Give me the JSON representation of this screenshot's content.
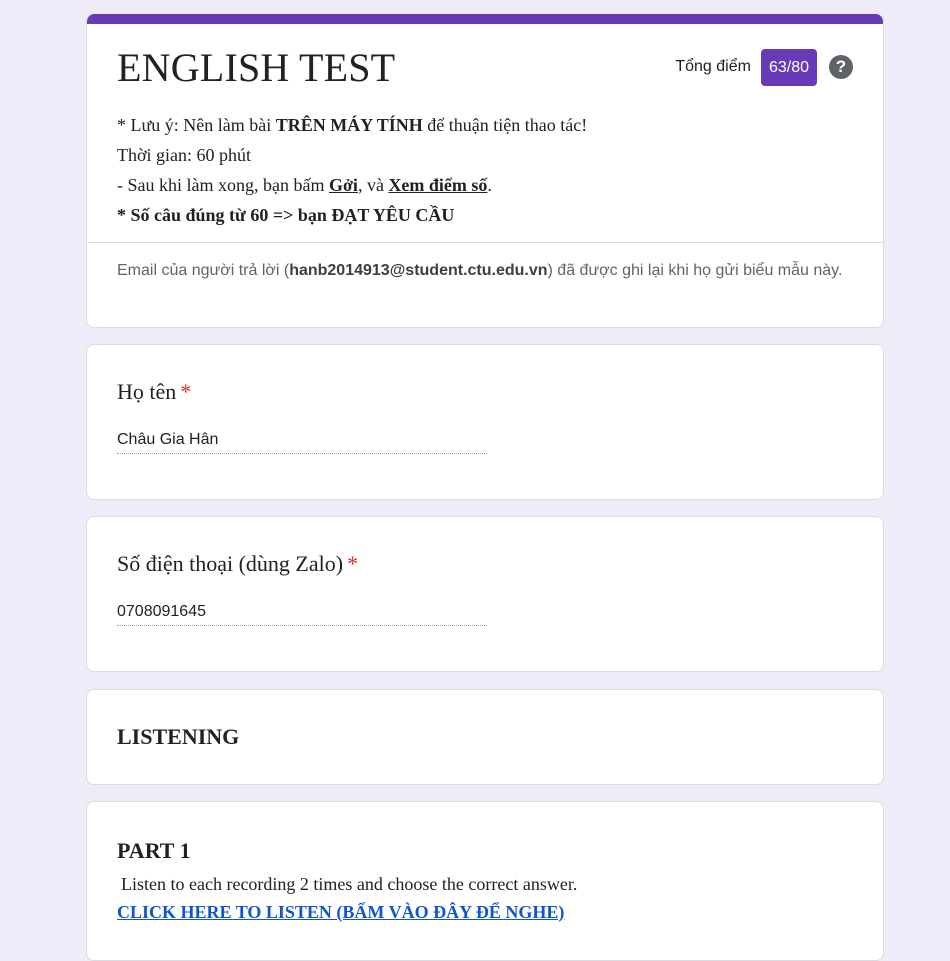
{
  "header": {
    "title": "ENGLISH TEST",
    "score_label": "Tổng điểm",
    "score_value": "63/80",
    "help_symbol": "?",
    "accent_color": "#673ab7"
  },
  "description": {
    "line1_prefix": "* Lưu ý: Nên làm bài ",
    "line1_bold": "TRÊN MÁY TÍNH",
    "line1_suffix": " để thuận tiện thao tác!",
    "line2": "Thời gian: 60 phút",
    "line3_prefix": "- Sau khi làm xong, bạn bấm ",
    "line3_submit": "Gởi",
    "line3_middle": ", và ",
    "line3_view": "Xem điểm số",
    "line3_suffix": ".",
    "line4": "* Số câu đúng từ 60 => bạn ĐẠT YÊU CẦU"
  },
  "email_note": {
    "prefix": "Email của người trả lời (",
    "email": "hanb2014913@student.ctu.edu.vn",
    "suffix": ") đã được ghi lại khi họ gửi biểu mẫu này."
  },
  "questions": [
    {
      "title": "Họ tên",
      "required_mark": "*",
      "answer": "Châu Gia Hân"
    },
    {
      "title": "Số điện thoại (dùng Zalo)",
      "required_mark": "*",
      "answer": "0708091645"
    }
  ],
  "section": {
    "title": "LISTENING"
  },
  "part": {
    "title": "PART 1",
    "instruction": "Listen to each recording 2 times and choose the correct answer.",
    "link_text": "CLICK HERE TO LISTEN (BẤM VÀO ĐÂY ĐỂ NGHE)"
  }
}
